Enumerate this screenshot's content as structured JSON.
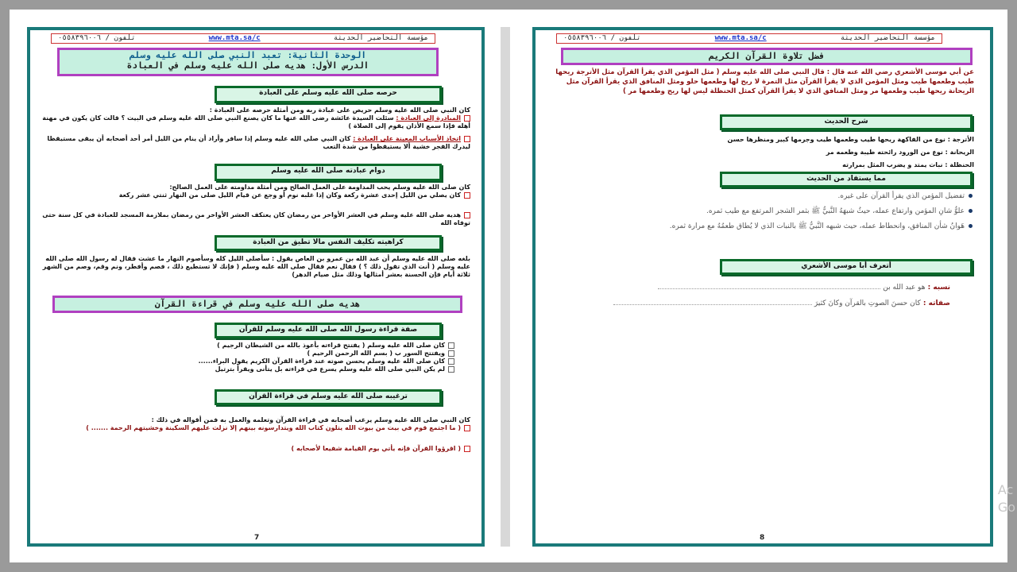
{
  "header": {
    "org": "مؤسسة التحاضير الحديثة",
    "site": "www.mta.sa/c",
    "phone": "تلفون / ٠٥٥٨٣٩٦٠٠٦"
  },
  "left": {
    "unit_title": "الوحدة الثانية: تعبد النبي صلى الله عليه وسلم",
    "lesson_title": "الدرس الأول: هديه صلى الله عليه وسلم في العبادة",
    "s1": "حرصه صلى الله عليه وسلم على العبادة",
    "s1_intro": "كان النبي صلى الله عليه وسلم حريص على عبادة ربه ومن أمثلة حرصه على العبادة :",
    "s1_b1_label": "المبادرة إلى العبادة :",
    "s1_b1": "سئلت السيدة عائشة رضى الله عنها ما كان يصنع النبي صلى الله عليه وسلم في البيت ؟ قالت كان يكون في مهنة أهله فإذا سمع الأذان يقوم إلى الصلاة )",
    "s1_b2_label": "اتخاذ الأسباب المعينة على العبادة :",
    "s1_b2": "كان النبي صلى الله عليه وسلم إذا سافر وأراد أن ينام من الليل أمر أحد أصحابه أن يبقى مستيقظا ليدرك الفجر خشية ألا يستيقظوا من شدة التعب",
    "s2": "دوام عبادته صلى الله عليه وسلم",
    "s2_intro": "كان صلى الله عليه وسلم يحب المداومة على العمل الصالح ومن أمثلة مداومته على العمل الصالح:",
    "s2_b1": "كان يصلي من الليل إحدى عشرة ركعة وكان إذا غلبه نوم أو وجع عن قيام الليل صلى من النهار ثنتي عشر ركعة",
    "s2_b2": "هديه صلى الله عليه وسلم في العشر الأواخر من رمضان كان يعتكف العشر الأواخر من رمضان بملازمة المسجد للعبادة في كل سنة حتى توفاه الله",
    "s3": "كراهيته تكليف النفس مالا تطيق من العبادة",
    "s3_text": "بلغه صلى الله عليه وسلم أن عبد الله بن عمرو بن العاص يقول : سأصلي الليل كله وسأصوم النهار ما عشت فقال له رسول الله صلى الله عليه وسلم ( أنت الذي تقول ذلك ؟ ) فقال نعم فقال صلى الله عليه وسلم ( فإنك لا تستطيع ذلك ، فصم وأفطر، ونم وقم، وصم من الشهر ثلاثة أيام فإن الحسنة بعشر أمثالها وذلك مثل صيام الدهر)",
    "unit2": "هديه صلى الله عليه وسلم في قراءة القرآن",
    "s4": "صفة قراءة رسول الله صلى الله عليه وسلم للقرآن",
    "s4_items": [
      "كان صلى الله عليه وسلم ( يفتتح قراءته بأعوذ بالله من الشيطان الرجيم )",
      "ويفتتح السور ب ( بسم الله الرحمن الرحيم )",
      "كان صلى الله عليه وسلم يحسن صوته عند قراءة القرآن الكريم يقول البراء......",
      "لم يكن النبي صلى الله عليه وسلم يسرع في قراءته بل يتأنى ويقرأ بترتيل"
    ],
    "s5": "ترغيبه صلى الله عليه وسلم في قراءة القرآن",
    "s5_intro": "كان النبي صلى الله عليه وسلم يرغب أصحابه في قراءة القرآن وتعلمه والعمل به فمن أقواله في ذلك :",
    "s5_b1": "( ما اجتمع قوم في بيت من بيوت الله يتلون كتاب الله ويتدارسونه بينهم إلا نزلت عليهم السكينة وخشيتهم الرحمة ....... )",
    "s5_b2": "( اقرؤوا القرآن فإنه يأتي يوم القيامة شفيعا لأصحابه )",
    "page_number": "7"
  },
  "right": {
    "s1": "فضل تلاوة القرآن الكريم",
    "hadith": "عن أبي موسى الأشعري رضي الله عنه قال : قال النبي صلى الله عليه وسلم ( مثل المؤمن الذي يقرأ القرآن مثل الأترجة ريحها طيب وطعمها طيب ومثل المؤمن الذي لا يقرأ القرآن مثل التمرة لا ريح لها وطعمها حلو ومثل المنافق الذي يقرأ القرآن مثل الريحانة ريحها طيب وطعمها مر ومثل المنافق الذي لا يقرأ القرآن كمثل الحنظلة ليس لها ريح وطعمها مر )",
    "s2": "شرح الحديث",
    "exp": [
      "الأترجة : نوع من الفاكهة ريحها طيب وطعمها طيب وجرمها كبير ومنظرها حسن",
      "الريحانة : نوع من الورود رائحته طيبة وطعمه مر",
      "الحنظلة : نبات يمتد و يضرب المثل بمرارته"
    ],
    "s3": "مما يستفاد من الحديث",
    "benefits": [
      "تفضيل المؤمن الذي يقرأ القرآن على غيره.",
      "علوُّ شانِ المؤمن وارتفاع عمله، حيثُ شبهَهُ النَّبيُّ ﷺ بثمر الشجر المرتفع مع طيب ثمره.",
      "هَوانُ شأن المنافق، وانحطاط عمله، حيث شبهه النَّبيُّ ﷺ بالنبات الذي لا يُطاق طعمُهُ مع مرارة ثمره."
    ],
    "s4": "أتعرف أبا موسى الأشعري",
    "nasab_label": "نسبه :",
    "nasab": "هو عبد الله بن",
    "sifat_label": "صفاته :",
    "sifat": "كان حسنَ الصوتِ بالقرآن وكانَ كثيرَ",
    "page_number": "8"
  },
  "watermark": [
    "Ac",
    "Go"
  ]
}
